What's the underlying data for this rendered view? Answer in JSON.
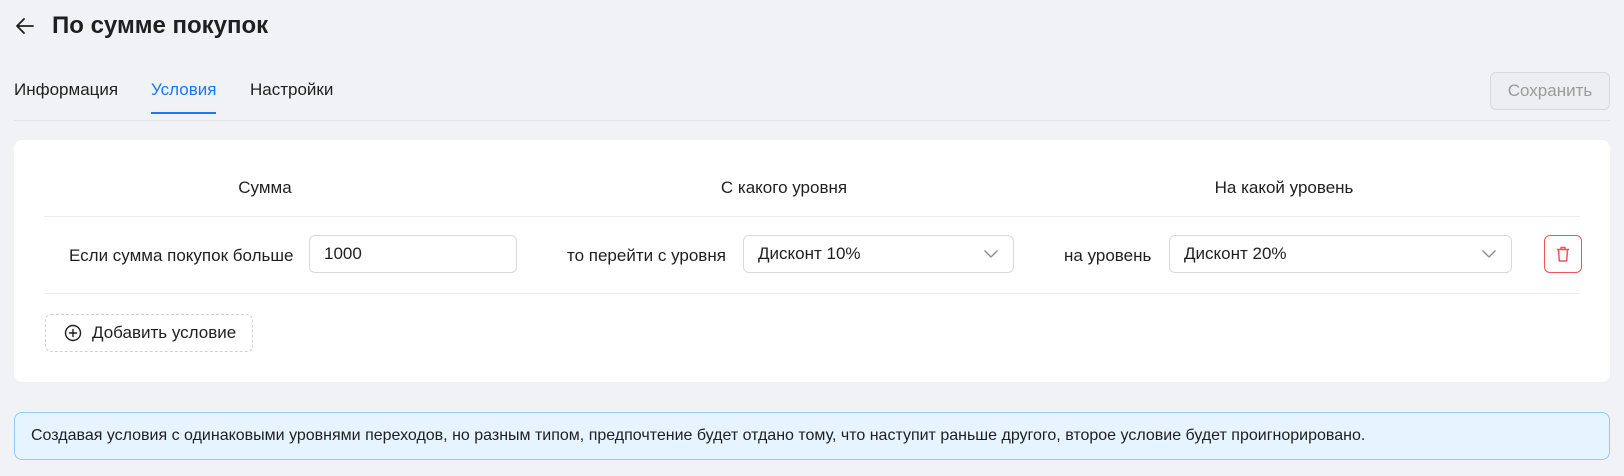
{
  "header": {
    "title": "По сумме покупок",
    "back_icon": "arrow-left-icon"
  },
  "tabs": [
    {
      "label": "Информация",
      "active": false
    },
    {
      "label": "Условия",
      "active": true
    },
    {
      "label": "Настройки",
      "active": false
    }
  ],
  "toolbar": {
    "save_label": "Сохранить",
    "save_disabled": true
  },
  "columns": {
    "sum": "Сумма",
    "from_level": "С какого уровня",
    "to_level": "На какой уровень"
  },
  "conditions": [
    {
      "sum_label": "Если сумма покупок больше",
      "sum_value": "1000",
      "from_label": "то перейти с уровня",
      "from_value": "Дисконт 10%",
      "to_label": "на уровень",
      "to_value": "Дисконт 20%"
    }
  ],
  "add_condition_label": "Добавить условие",
  "info_text": "Создавая условия с одинаковыми уровнями переходов, но разным типом, предпочтение будет отдано тому, что наступит раньше другого, второе условие будет проигнорировано.",
  "colors": {
    "accent": "#1677ff",
    "danger": "#f1525b",
    "info_bg": "#e6f4ff",
    "info_border": "#91caff"
  }
}
